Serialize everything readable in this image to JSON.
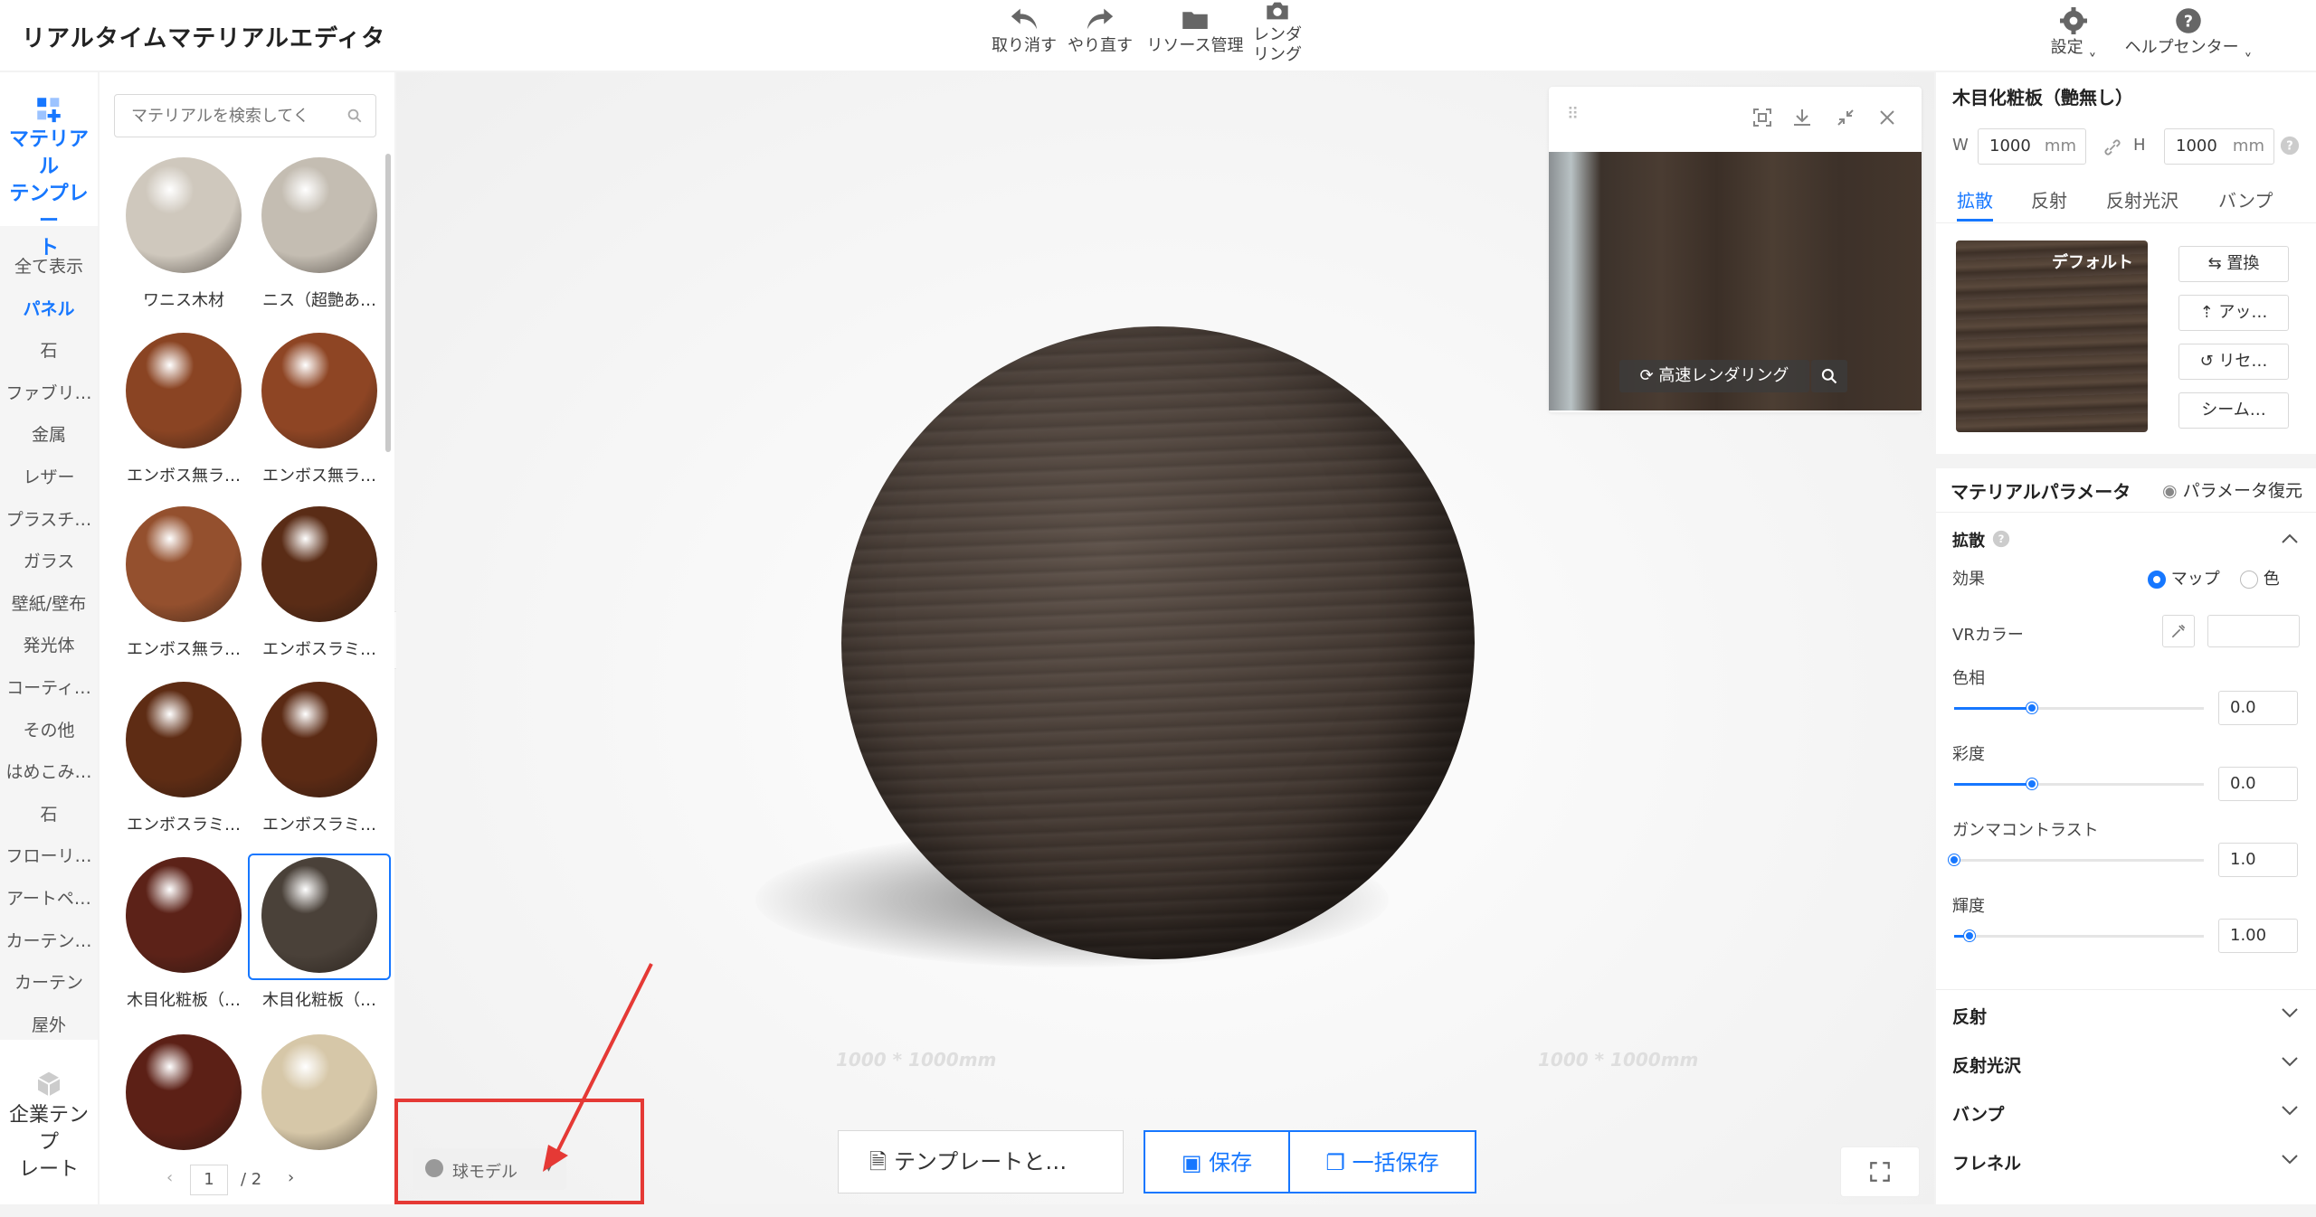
{
  "app": {
    "title": "リアルタイムマテリアルエディタ"
  },
  "toolbar": {
    "undo": "取り消す",
    "redo": "やり直す",
    "resources": "リソース管理",
    "render_line1": "レンダ",
    "render_line2": "リング",
    "settings": "設定",
    "help": "ヘルプセンター"
  },
  "rail": {
    "template_tab_lines": [
      "マテリアル",
      "テンプレー",
      "ト"
    ],
    "categories": [
      "全て表示",
      "パネル",
      "石",
      "ファブリ…",
      "金属",
      "レザー",
      "プラスチ…",
      "ガラス",
      "壁紙/壁布",
      "発光体",
      "コーティ…",
      "その他",
      "はめこみ…",
      "石",
      "フローリ…",
      "アートペ…",
      "カーテン…",
      "カーテン",
      "屋外"
    ],
    "active_category": "パネル",
    "enterprise_tab_lines": [
      "企業テンプ",
      "レート"
    ]
  },
  "search": {
    "placeholder": "マテリアルを検索してく"
  },
  "materials": [
    {
      "name": "ワニス木材",
      "color": "#cfc8bd"
    },
    {
      "name": "ニス（超艶あ…",
      "color": "#c4bdb2"
    },
    {
      "name": "エンボス無ラ…",
      "color": "#8a4423"
    },
    {
      "name": "エンボス無ラ…",
      "color": "#8e4524"
    },
    {
      "name": "エンボス無ラ…",
      "color": "#94502e"
    },
    {
      "name": "エンボスラミ…",
      "color": "#5a2c16"
    },
    {
      "name": "エンボスラミ…",
      "color": "#5e2c14"
    },
    {
      "name": "エンボスラミ…",
      "color": "#5b2a14"
    },
    {
      "name": "木目化粧板（…",
      "color": "#5c2218"
    },
    {
      "name": "木目化粧板（…",
      "color": "#4a4139"
    },
    {
      "name": "",
      "color": "#5c2016"
    },
    {
      "name": "",
      "color": "#d6c7a8"
    }
  ],
  "pager": {
    "current": "1",
    "total": "/ 2"
  },
  "preview": {
    "render_label": "高速レンダリング"
  },
  "viewport": {
    "floor_label": "1000 * 1000mm"
  },
  "panel": {
    "title": "木目化粧板（艶無し）",
    "w_label": "W",
    "w_value": "1000",
    "h_label": "H",
    "h_value": "1000",
    "unit": "mm",
    "tabs": [
      "拡散",
      "反射",
      "反射光沢",
      "バンプ"
    ],
    "active_tab": "拡散",
    "texture_badge": "デフォルト",
    "buttons": [
      "置換",
      "アッ…",
      "リセ…",
      "シーム…"
    ],
    "params_title": "マテリアルパラメータ",
    "params_reset": "パラメータ復元",
    "diffuse_section": "拡散",
    "effect_label": "効果",
    "effect_options": [
      "マップ",
      "色"
    ],
    "effect_selected": "マップ",
    "vr_color_label": "VRカラー",
    "sliders": [
      {
        "label": "色相",
        "value": "0.0",
        "fraction": 0.31
      },
      {
        "label": "彩度",
        "value": "0.0",
        "fraction": 0.31
      },
      {
        "label": "ガンマコントラスト",
        "value": "1.0",
        "fraction": 0.0
      },
      {
        "label": "輝度",
        "value": "1.00",
        "fraction": 0.06
      }
    ],
    "collapsed_sections": [
      "反射",
      "反射光沢",
      "バンプ",
      "フレネル"
    ]
  },
  "bottom": {
    "model_select": "球モデル",
    "template_btn": "テンプレートと…",
    "save_btn": "保存",
    "batch_save_btn": "一括保存"
  },
  "colors": {
    "accent": "#1677ff",
    "highlight": "#e53935"
  }
}
